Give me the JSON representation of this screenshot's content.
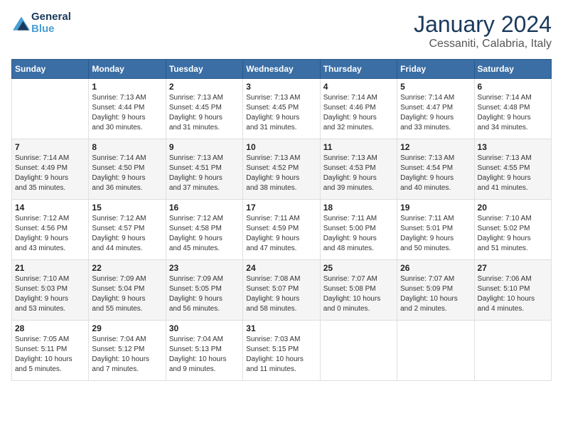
{
  "header": {
    "logo_general": "General",
    "logo_blue": "Blue",
    "month_title": "January 2024",
    "subtitle": "Cessaniti, Calabria, Italy"
  },
  "days_of_week": [
    "Sunday",
    "Monday",
    "Tuesday",
    "Wednesday",
    "Thursday",
    "Friday",
    "Saturday"
  ],
  "weeks": [
    [
      {
        "day": "",
        "info": ""
      },
      {
        "day": "1",
        "info": "Sunrise: 7:13 AM\nSunset: 4:44 PM\nDaylight: 9 hours\nand 30 minutes."
      },
      {
        "day": "2",
        "info": "Sunrise: 7:13 AM\nSunset: 4:45 PM\nDaylight: 9 hours\nand 31 minutes."
      },
      {
        "day": "3",
        "info": "Sunrise: 7:13 AM\nSunset: 4:45 PM\nDaylight: 9 hours\nand 31 minutes."
      },
      {
        "day": "4",
        "info": "Sunrise: 7:14 AM\nSunset: 4:46 PM\nDaylight: 9 hours\nand 32 minutes."
      },
      {
        "day": "5",
        "info": "Sunrise: 7:14 AM\nSunset: 4:47 PM\nDaylight: 9 hours\nand 33 minutes."
      },
      {
        "day": "6",
        "info": "Sunrise: 7:14 AM\nSunset: 4:48 PM\nDaylight: 9 hours\nand 34 minutes."
      }
    ],
    [
      {
        "day": "7",
        "info": "Sunrise: 7:14 AM\nSunset: 4:49 PM\nDaylight: 9 hours\nand 35 minutes."
      },
      {
        "day": "8",
        "info": "Sunrise: 7:14 AM\nSunset: 4:50 PM\nDaylight: 9 hours\nand 36 minutes."
      },
      {
        "day": "9",
        "info": "Sunrise: 7:13 AM\nSunset: 4:51 PM\nDaylight: 9 hours\nand 37 minutes."
      },
      {
        "day": "10",
        "info": "Sunrise: 7:13 AM\nSunset: 4:52 PM\nDaylight: 9 hours\nand 38 minutes."
      },
      {
        "day": "11",
        "info": "Sunrise: 7:13 AM\nSunset: 4:53 PM\nDaylight: 9 hours\nand 39 minutes."
      },
      {
        "day": "12",
        "info": "Sunrise: 7:13 AM\nSunset: 4:54 PM\nDaylight: 9 hours\nand 40 minutes."
      },
      {
        "day": "13",
        "info": "Sunrise: 7:13 AM\nSunset: 4:55 PM\nDaylight: 9 hours\nand 41 minutes."
      }
    ],
    [
      {
        "day": "14",
        "info": "Sunrise: 7:12 AM\nSunset: 4:56 PM\nDaylight: 9 hours\nand 43 minutes."
      },
      {
        "day": "15",
        "info": "Sunrise: 7:12 AM\nSunset: 4:57 PM\nDaylight: 9 hours\nand 44 minutes."
      },
      {
        "day": "16",
        "info": "Sunrise: 7:12 AM\nSunset: 4:58 PM\nDaylight: 9 hours\nand 45 minutes."
      },
      {
        "day": "17",
        "info": "Sunrise: 7:11 AM\nSunset: 4:59 PM\nDaylight: 9 hours\nand 47 minutes."
      },
      {
        "day": "18",
        "info": "Sunrise: 7:11 AM\nSunset: 5:00 PM\nDaylight: 9 hours\nand 48 minutes."
      },
      {
        "day": "19",
        "info": "Sunrise: 7:11 AM\nSunset: 5:01 PM\nDaylight: 9 hours\nand 50 minutes."
      },
      {
        "day": "20",
        "info": "Sunrise: 7:10 AM\nSunset: 5:02 PM\nDaylight: 9 hours\nand 51 minutes."
      }
    ],
    [
      {
        "day": "21",
        "info": "Sunrise: 7:10 AM\nSunset: 5:03 PM\nDaylight: 9 hours\nand 53 minutes."
      },
      {
        "day": "22",
        "info": "Sunrise: 7:09 AM\nSunset: 5:04 PM\nDaylight: 9 hours\nand 55 minutes."
      },
      {
        "day": "23",
        "info": "Sunrise: 7:09 AM\nSunset: 5:05 PM\nDaylight: 9 hours\nand 56 minutes."
      },
      {
        "day": "24",
        "info": "Sunrise: 7:08 AM\nSunset: 5:07 PM\nDaylight: 9 hours\nand 58 minutes."
      },
      {
        "day": "25",
        "info": "Sunrise: 7:07 AM\nSunset: 5:08 PM\nDaylight: 10 hours\nand 0 minutes."
      },
      {
        "day": "26",
        "info": "Sunrise: 7:07 AM\nSunset: 5:09 PM\nDaylight: 10 hours\nand 2 minutes."
      },
      {
        "day": "27",
        "info": "Sunrise: 7:06 AM\nSunset: 5:10 PM\nDaylight: 10 hours\nand 4 minutes."
      }
    ],
    [
      {
        "day": "28",
        "info": "Sunrise: 7:05 AM\nSunset: 5:11 PM\nDaylight: 10 hours\nand 5 minutes."
      },
      {
        "day": "29",
        "info": "Sunrise: 7:04 AM\nSunset: 5:12 PM\nDaylight: 10 hours\nand 7 minutes."
      },
      {
        "day": "30",
        "info": "Sunrise: 7:04 AM\nSunset: 5:13 PM\nDaylight: 10 hours\nand 9 minutes."
      },
      {
        "day": "31",
        "info": "Sunrise: 7:03 AM\nSunset: 5:15 PM\nDaylight: 10 hours\nand 11 minutes."
      },
      {
        "day": "",
        "info": ""
      },
      {
        "day": "",
        "info": ""
      },
      {
        "day": "",
        "info": ""
      }
    ]
  ]
}
